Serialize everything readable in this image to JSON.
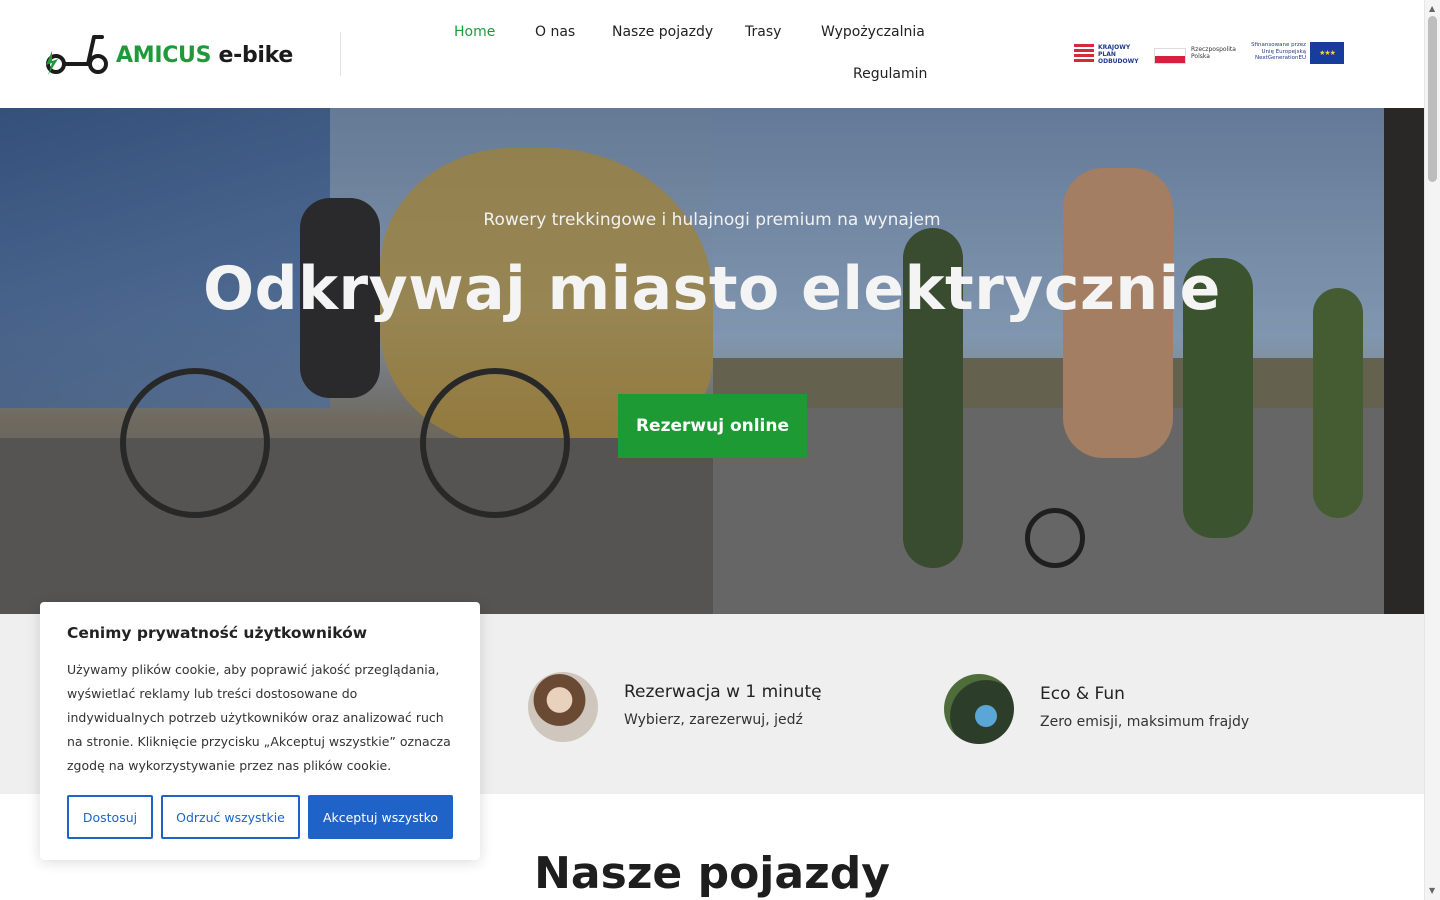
{
  "brand": {
    "name": "AMICUS",
    "suffix": "e-bike"
  },
  "nav": {
    "items": [
      "Home",
      "O nas",
      "Nasze pojazdy",
      "Trasy",
      "Wypożyczalnia",
      "Regulamin"
    ],
    "active": "Home"
  },
  "funding": {
    "kpo": "KRAJOWY PLAN ODBUDOWY",
    "rp": "Rzeczpospolita Polska",
    "eu": "Sfinansowane przez Unię Europejską NextGenerationEU"
  },
  "hero": {
    "subtitle": "Rowery trekkingowe i hulajnogi premium na wynajem",
    "title": "Odkrywaj miasto elektrycznie",
    "cta": "Rezerwuj online"
  },
  "features": [
    {
      "title": "Rezerwacja w 1 minutę",
      "desc": "Wybierz, zarezerwuj, jedź"
    },
    {
      "title": "Eco & Fun",
      "desc": "Zero emisji, maksimum frajdy"
    }
  ],
  "section": {
    "title": "Nasze pojazdy"
  },
  "cookie": {
    "title": "Cenimy prywatność użytkowników",
    "text": "Używamy plików cookie, aby poprawić jakość przeglądania, wyświetlać reklamy lub treści dostosowane do indywidualnych potrzeb użytkowników oraz analizować ruch na stronie. Kliknięcie przycisku „Akceptuj wszystkie” oznacza zgodę na wykorzystywanie przez nas plików cookie.",
    "customize": "Dostosuj",
    "reject": "Odrzuć wszystkie",
    "accept": "Akceptuj wszystko"
  },
  "colors": {
    "accent": "#1f9a3a",
    "button_green": "#1e9a35",
    "cookie_blue": "#1f63c8"
  }
}
